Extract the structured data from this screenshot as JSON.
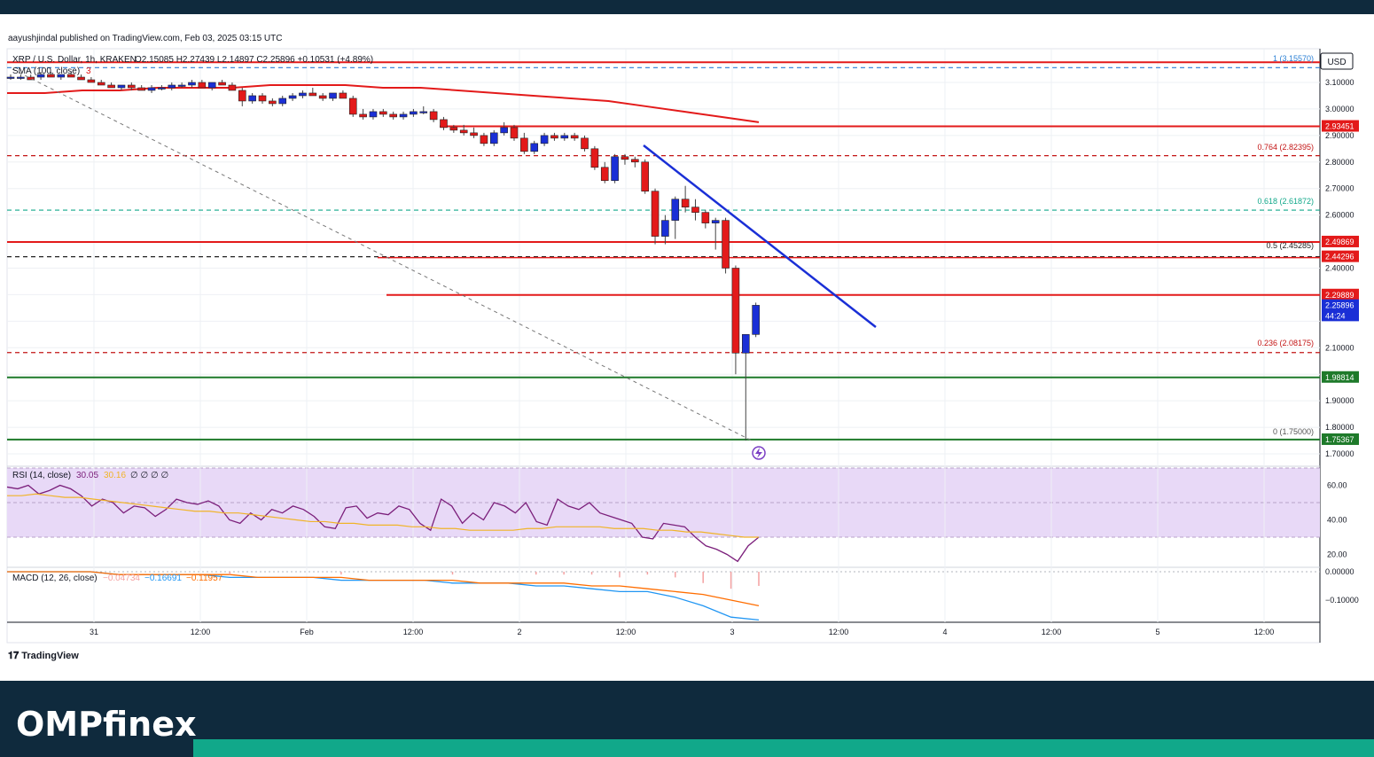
{
  "header": {
    "published_text": "aayushjindal published on TradingView.com, Feb 03, 2025 03:15 UTC"
  },
  "legend": {
    "symbol": "XRP / U.S. Dollar, 1h, KRAKEN",
    "ohlc": "O2.15085 H2.27439 L2.14897 C2.25896 +0.10531 (+4.89%)",
    "sma_label": "SMA (100, close)",
    "sma_value": "3",
    "rsi_label": "RSI (14, close)",
    "rsi_value": "30.05",
    "rsi_ma_value": "30.16",
    "rsi_nulls": "∅ ∅ ∅ ∅",
    "macd_label": "MACD (12, 26, close)",
    "macd_hist": "−0.04734",
    "macd_line": "−0.16691",
    "macd_signal": "−0.11957"
  },
  "price_axis": {
    "currency": "USD",
    "ticks": [
      "3.10000",
      "3.00000",
      "2.90000",
      "2.80000",
      "2.70000",
      "2.60000",
      "2.40000",
      "2.10000",
      "1.90000",
      "1.80000",
      "1.70000"
    ],
    "tags": [
      {
        "label": "2.93451",
        "color": "#e31a1a"
      },
      {
        "label": "2.49869",
        "color": "#e31a1a"
      },
      {
        "label": "2.44296",
        "color": "#e31a1a"
      },
      {
        "label": "2.29889",
        "color": "#e31a1a"
      },
      {
        "label": "2.25896",
        "color": "#1a2fd6"
      },
      {
        "label": "44:24",
        "color": "#1a2fd6"
      },
      {
        "label": "1.98814",
        "color": "#1e7a2a"
      },
      {
        "label": "1.75367",
        "color": "#1e7a2a"
      }
    ]
  },
  "rsi_axis": {
    "ticks": [
      "60.00",
      "40.00",
      "20.00"
    ]
  },
  "macd_axis": {
    "ticks": [
      "0.00000",
      "−0.10000"
    ]
  },
  "time_axis": {
    "ticks": [
      "31",
      "12:00",
      "Feb",
      "12:00",
      "2",
      "12:00",
      "3",
      "12:00",
      "4",
      "12:00",
      "5",
      "12:00"
    ]
  },
  "fib_labels": [
    {
      "label": "1 (3.15570)",
      "color": "#2a7fd4"
    },
    {
      "label": "0.764 (2.82395)",
      "color": "#c31515"
    },
    {
      "label": "0.618 (2.61872)",
      "color": "#11a88a"
    },
    {
      "label": "0.5 (2.45285)",
      "color": "#222222"
    },
    {
      "label": "0.236 (2.08175)",
      "color": "#c31515"
    },
    {
      "label": "0 (1.75000)",
      "color": "#555555"
    }
  ],
  "footer": {
    "tradingview": "TradingView",
    "brand": "OMPfinex"
  },
  "colors": {
    "up": "#1a2fd6",
    "down": "#e31a1a",
    "sma": "#e31a1a",
    "trendline": "#1a2fd6",
    "support": "#1e7a2a",
    "rsi_line": "#7b1f7b",
    "rsi_ma": "#f0b429",
    "macd_line": "#2196f3",
    "macd_signal": "#ff6d00",
    "footer_bg": "#0f2a3d",
    "footer_accent": "#11a88a"
  },
  "chart_data": {
    "type": "candlestick",
    "title": "XRP / U.S. Dollar, 1h, KRAKEN",
    "ylim": [
      1.68,
      3.18
    ],
    "horizontal_levels": [
      {
        "value": 3.176,
        "color": "#e31a1a",
        "style": "solid"
      },
      {
        "value": 3.1557,
        "color": "#2a7fd4",
        "style": "dashed"
      },
      {
        "value": 2.93451,
        "color": "#e31a1a",
        "style": "solid"
      },
      {
        "value": 2.82395,
        "color": "#c31515",
        "style": "dashed"
      },
      {
        "value": 2.61872,
        "color": "#11a88a",
        "style": "dashed"
      },
      {
        "value": 2.49869,
        "color": "#e31a1a",
        "style": "solid"
      },
      {
        "value": 2.44296,
        "color": "#222222",
        "style": "dashed"
      },
      {
        "value": 2.29889,
        "color": "#e31a1a",
        "style": "solid"
      },
      {
        "value": 2.08175,
        "color": "#c31515",
        "style": "dashed"
      },
      {
        "value": 1.98814,
        "color": "#1e7a2a",
        "style": "solid"
      },
      {
        "value": 1.75367,
        "color": "#1e7a2a",
        "style": "solid"
      }
    ],
    "candles": [
      [
        3.12,
        3.13,
        3.11,
        3.12
      ],
      [
        3.12,
        3.13,
        3.11,
        3.12
      ],
      [
        3.12,
        3.13,
        3.11,
        3.11
      ],
      [
        3.12,
        3.14,
        3.11,
        3.13
      ],
      [
        3.13,
        3.14,
        3.12,
        3.12
      ],
      [
        3.12,
        3.13,
        3.11,
        3.13
      ],
      [
        3.13,
        3.14,
        3.12,
        3.12
      ],
      [
        3.12,
        3.13,
        3.11,
        3.11
      ],
      [
        3.11,
        3.12,
        3.1,
        3.1
      ],
      [
        3.1,
        3.11,
        3.09,
        3.09
      ],
      [
        3.09,
        3.1,
        3.08,
        3.08
      ],
      [
        3.08,
        3.09,
        3.07,
        3.09
      ],
      [
        3.09,
        3.1,
        3.07,
        3.08
      ],
      [
        3.08,
        3.09,
        3.07,
        3.07
      ],
      [
        3.07,
        3.09,
        3.06,
        3.08
      ],
      [
        3.08,
        3.09,
        3.07,
        3.08
      ],
      [
        3.08,
        3.1,
        3.07,
        3.09
      ],
      [
        3.09,
        3.1,
        3.08,
        3.09
      ],
      [
        3.09,
        3.11,
        3.08,
        3.1
      ],
      [
        3.1,
        3.11,
        3.08,
        3.08
      ],
      [
        3.08,
        3.1,
        3.07,
        3.1
      ],
      [
        3.1,
        3.11,
        3.09,
        3.09
      ],
      [
        3.09,
        3.1,
        3.07,
        3.07
      ],
      [
        3.07,
        3.08,
        3.01,
        3.03
      ],
      [
        3.03,
        3.06,
        3.02,
        3.05
      ],
      [
        3.05,
        3.06,
        3.02,
        3.03
      ],
      [
        3.03,
        3.04,
        3.01,
        3.02
      ],
      [
        3.02,
        3.05,
        3.01,
        3.04
      ],
      [
        3.04,
        3.06,
        3.03,
        3.05
      ],
      [
        3.05,
        3.07,
        3.04,
        3.06
      ],
      [
        3.06,
        3.08,
        3.05,
        3.05
      ],
      [
        3.05,
        3.06,
        3.03,
        3.04
      ],
      [
        3.04,
        3.06,
        3.03,
        3.06
      ],
      [
        3.06,
        3.07,
        3.04,
        3.04
      ],
      [
        3.04,
        3.05,
        2.97,
        2.98
      ],
      [
        2.98,
        3.0,
        2.96,
        2.97
      ],
      [
        2.97,
        3.0,
        2.96,
        2.99
      ],
      [
        2.99,
        3.0,
        2.97,
        2.98
      ],
      [
        2.98,
        2.99,
        2.96,
        2.97
      ],
      [
        2.97,
        2.99,
        2.96,
        2.98
      ],
      [
        2.98,
        3.0,
        2.97,
        2.99
      ],
      [
        2.99,
        3.01,
        2.98,
        2.99
      ],
      [
        2.99,
        3.0,
        2.95,
        2.96
      ],
      [
        2.96,
        2.97,
        2.92,
        2.93
      ],
      [
        2.93,
        2.94,
        2.91,
        2.92
      ],
      [
        2.92,
        2.94,
        2.9,
        2.91
      ],
      [
        2.91,
        2.93,
        2.89,
        2.9
      ],
      [
        2.9,
        2.91,
        2.86,
        2.87
      ],
      [
        2.87,
        2.92,
        2.86,
        2.91
      ],
      [
        2.91,
        2.95,
        2.9,
        2.93
      ],
      [
        2.93,
        2.94,
        2.88,
        2.89
      ],
      [
        2.89,
        2.91,
        2.83,
        2.84
      ],
      [
        2.84,
        2.88,
        2.83,
        2.87
      ],
      [
        2.87,
        2.91,
        2.86,
        2.9
      ],
      [
        2.9,
        2.91,
        2.88,
        2.89
      ],
      [
        2.89,
        2.91,
        2.88,
        2.9
      ],
      [
        2.9,
        2.91,
        2.88,
        2.89
      ],
      [
        2.89,
        2.9,
        2.84,
        2.85
      ],
      [
        2.85,
        2.86,
        2.77,
        2.78
      ],
      [
        2.78,
        2.8,
        2.72,
        2.73
      ],
      [
        2.73,
        2.83,
        2.72,
        2.82
      ],
      [
        2.82,
        2.83,
        2.79,
        2.81
      ],
      [
        2.81,
        2.82,
        2.78,
        2.8
      ],
      [
        2.8,
        2.81,
        2.68,
        2.69
      ],
      [
        2.69,
        2.7,
        2.49,
        2.52
      ],
      [
        2.52,
        2.6,
        2.49,
        2.58
      ],
      [
        2.58,
        2.67,
        2.51,
        2.66
      ],
      [
        2.66,
        2.71,
        2.61,
        2.63
      ],
      [
        2.63,
        2.66,
        2.58,
        2.61
      ],
      [
        2.61,
        2.62,
        2.55,
        2.57
      ],
      [
        2.57,
        2.59,
        2.47,
        2.58
      ],
      [
        2.58,
        2.59,
        2.38,
        2.4
      ],
      [
        2.4,
        2.41,
        2.0,
        2.08
      ],
      [
        2.08,
        2.15,
        1.75,
        2.15
      ],
      [
        2.15,
        2.27,
        2.14,
        2.26
      ]
    ],
    "sma_100": [
      3.06,
      3.06,
      3.07,
      3.07,
      3.08,
      3.08,
      3.08,
      3.09,
      3.09,
      3.09,
      3.08,
      3.08,
      3.07,
      3.06,
      3.05,
      3.04,
      3.03,
      3.01,
      2.99,
      2.97,
      2.95
    ],
    "trendline": [
      [
        64,
        2.87
      ],
      [
        100,
        2.17
      ]
    ],
    "fib_line": [
      [
        0,
        3.15
      ],
      [
        73,
        1.75
      ]
    ],
    "rsi": [
      59,
      58,
      60,
      55,
      57,
      60,
      58,
      54,
      48,
      52,
      50,
      44,
      48,
      47,
      42,
      46,
      52,
      50,
      49,
      51,
      48,
      40,
      38,
      44,
      40,
      46,
      44,
      48,
      46,
      42,
      36,
      35,
      47,
      48,
      41,
      44,
      43,
      48,
      46,
      38,
      34,
      52,
      48,
      38,
      44,
      40,
      50,
      48,
      44,
      50,
      39,
      37,
      52,
      48,
      46,
      50,
      44,
      42,
      40,
      38,
      30,
      29,
      38,
      37,
      36,
      30,
      25,
      23,
      20,
      16,
      25,
      30
    ],
    "rsi_ma": [
      54,
      54,
      55,
      54,
      53,
      53,
      52,
      51,
      50,
      49,
      48,
      47,
      46,
      45,
      45,
      44,
      44,
      43,
      42,
      41,
      40,
      39,
      39,
      38,
      38,
      37,
      37,
      37,
      36,
      36,
      35,
      35,
      34,
      34,
      34,
      34,
      35,
      35,
      36,
      36,
      36,
      36,
      35,
      35,
      35,
      34,
      34,
      33,
      33,
      32,
      31,
      30,
      30
    ],
    "macd": [
      0.0,
      0.0,
      0.0,
      0.0,
      -0.01,
      -0.01,
      -0.01,
      -0.01,
      -0.02,
      -0.02,
      -0.02,
      -0.02,
      -0.03,
      -0.03,
      -0.03,
      -0.03,
      -0.04,
      -0.04,
      -0.04,
      -0.05,
      -0.05,
      -0.06,
      -0.07,
      -0.07,
      -0.09,
      -0.12,
      -0.16,
      -0.17
    ],
    "macd_signal": [
      0.0,
      0.0,
      0.0,
      0.0,
      -0.01,
      -0.01,
      -0.01,
      -0.01,
      -0.01,
      -0.02,
      -0.02,
      -0.02,
      -0.02,
      -0.03,
      -0.03,
      -0.03,
      -0.03,
      -0.04,
      -0.04,
      -0.04,
      -0.04,
      -0.05,
      -0.05,
      -0.06,
      -0.07,
      -0.08,
      -0.1,
      -0.12
    ]
  }
}
